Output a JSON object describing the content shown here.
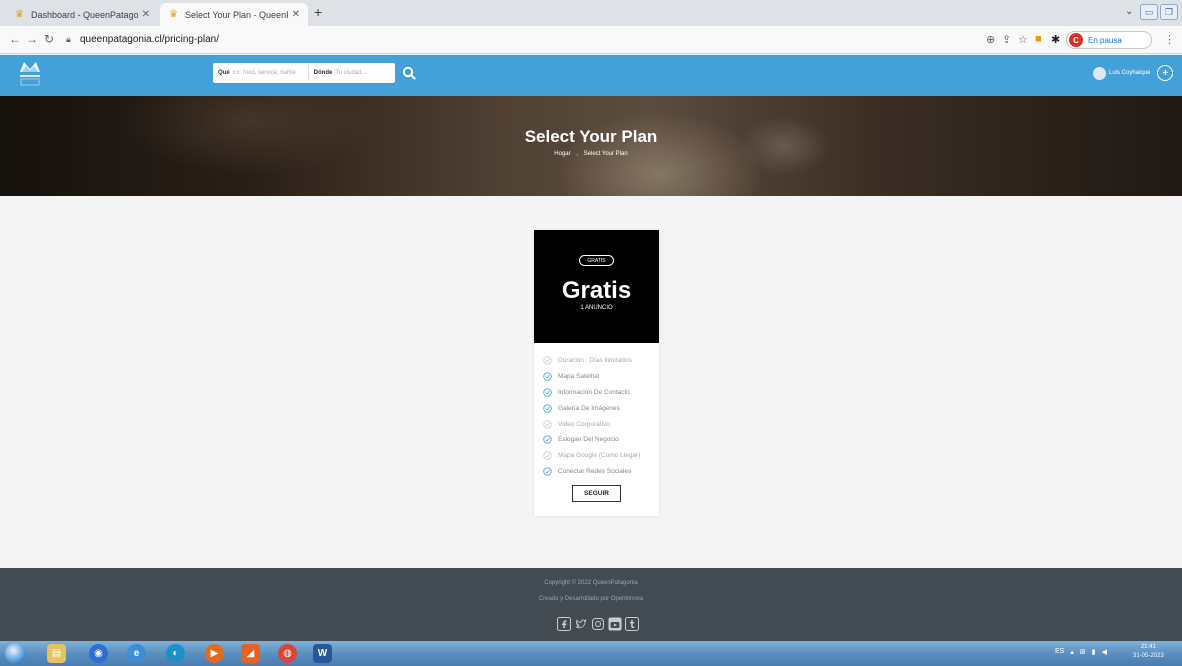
{
  "browser": {
    "tabs": [
      {
        "title": "Dashboard - QueenPatagonia",
        "active": false
      },
      {
        "title": "Select Your Plan - QueenPatagon",
        "active": true
      }
    ],
    "new_tab": "+",
    "url": "queenpatagonia.cl/pricing-plan/",
    "profile_initial": "C",
    "profile_status": "En pausa"
  },
  "header": {
    "search": {
      "what_label": "Qué",
      "what_placeholder": "Ex: food, service, barbe",
      "where_label": "Dónde",
      "where_placeholder": "Tu ciudad..."
    },
    "user_name": "Luis Coyhaique"
  },
  "hero": {
    "title": "Select Your Plan",
    "breadcrumb": [
      "Hogar",
      "Select Your Plan"
    ],
    "breadcrumb_sep": ","
  },
  "plan": {
    "badge": "GRATIS",
    "price": "Gratis",
    "subtitle": "1 ANUNCIO",
    "features": [
      {
        "label": "Duración : Días ilimitados",
        "included": false
      },
      {
        "label": "Mapa Satelital",
        "included": true
      },
      {
        "label": "Información De Contacto",
        "included": true
      },
      {
        "label": "Galería De Imágenes",
        "included": true
      },
      {
        "label": "Video Corporativo",
        "included": false
      },
      {
        "label": "Eslogan Del Negocio",
        "included": true
      },
      {
        "label": "Mapa Google (Como Llegar)",
        "included": false
      },
      {
        "label": "Conectar Redes Sociales",
        "included": true
      }
    ],
    "button_label": "SEGUIR"
  },
  "footer": {
    "copyright": "Copyright © 2022 QueenPatagonia",
    "made_by": "Creado y Desarrollado por Openinnova",
    "socials": [
      "facebook-icon",
      "twitter-icon",
      "instagram-icon",
      "youtube-icon",
      "tumblr-icon"
    ]
  },
  "taskbar": {
    "language": "ES",
    "time": "21:41",
    "date": "31-05-2023"
  },
  "colors": {
    "header_blue": "#44a0d8",
    "footer": "#424b52",
    "check": "#44a0d8"
  }
}
